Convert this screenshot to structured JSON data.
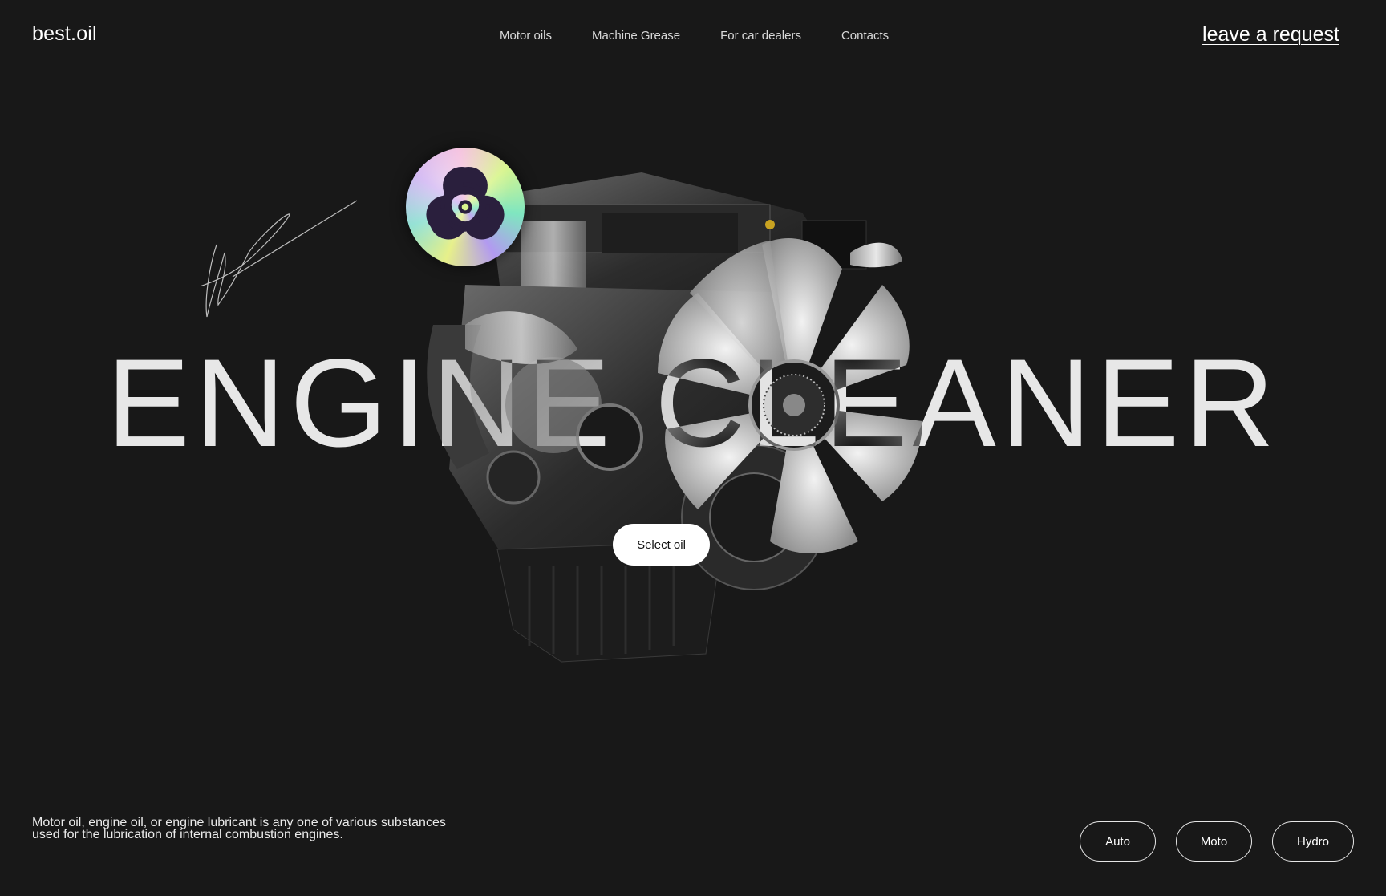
{
  "header": {
    "logo": "best.oil",
    "nav": [
      "Motor oils",
      "Machine Grease",
      "For car dealers",
      "Contacts"
    ],
    "request_link": "leave a request"
  },
  "hero": {
    "headline": "ENGINE CLEANER",
    "cta_label": "Select oil",
    "badge_icon": "biohazard-icon",
    "decoration_icon": "signature-icon"
  },
  "footer": {
    "description": "Motor oil, engine oil, or engine lubricant is any one of various substances used for the lubrication of internal combustion engines.",
    "categories": [
      "Auto",
      "Moto",
      "Hydro"
    ]
  },
  "colors": {
    "background": "#181818",
    "text": "#ffffff",
    "button_bg": "#ffffff",
    "button_text": "#111111"
  }
}
